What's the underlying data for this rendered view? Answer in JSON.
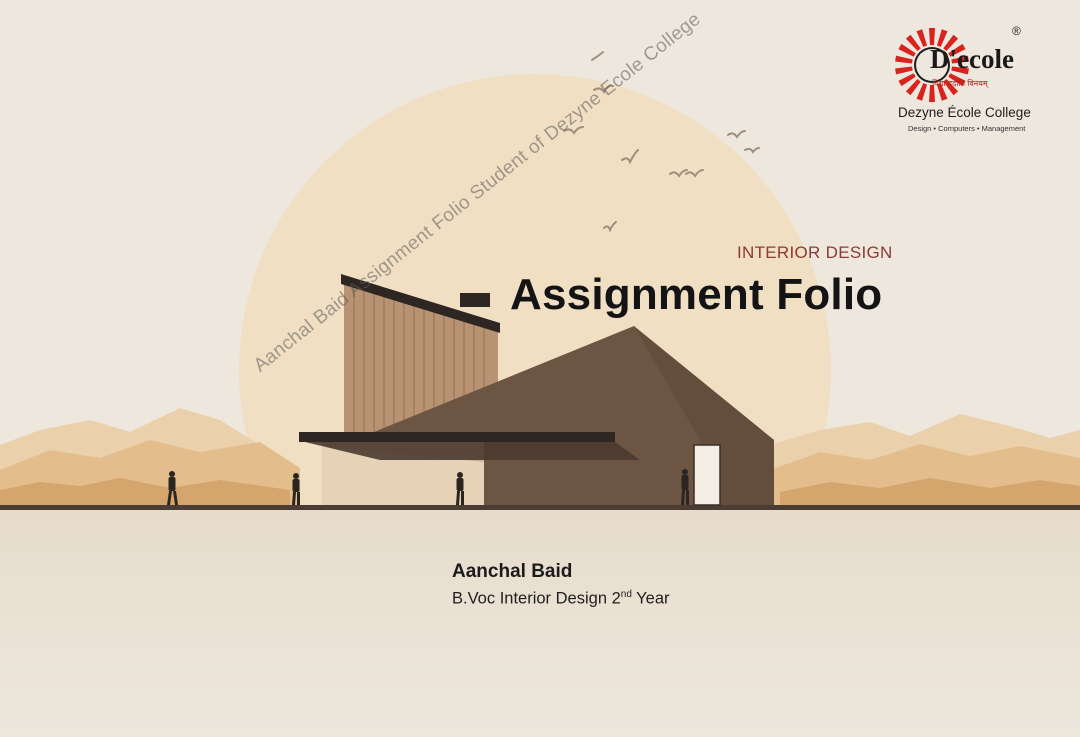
{
  "brand": {
    "logo_word": "D'ecole",
    "registered_mark": "®",
    "hindi_tagline": "विद्या ददाति विनयम्",
    "college_name": "Dezyne École College",
    "tagline": "Design • Computers • Management"
  },
  "cover": {
    "subtitle": "INTERIOR DESIGN",
    "title": "Assignment Folio"
  },
  "student": {
    "name": "Aanchal Baid",
    "course_prefix": "B.Voc Interior Design 2",
    "course_ordinal": "nd",
    "course_suffix": " Year"
  },
  "watermark": {
    "text": "Aanchal Baid Assignment Folio Student of Dezyne Ecole College"
  },
  "colors": {
    "background": "#ede7dd",
    "sun": "#f1dfc3",
    "mountain": "#e3be8c",
    "building_dark": "#6d5544",
    "wood": "#b89373",
    "subtitle": "#8b3b35",
    "logo_red": "#d8231f"
  }
}
